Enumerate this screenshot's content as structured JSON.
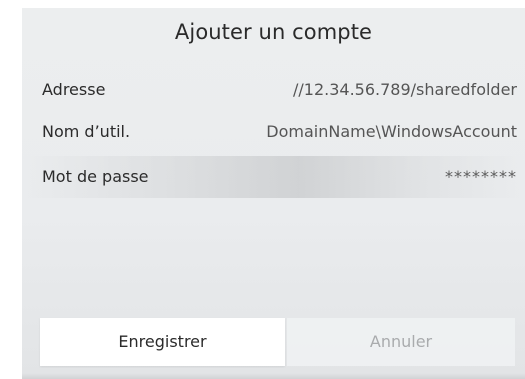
{
  "dialog": {
    "title": "Ajouter un compte",
    "fields": {
      "address": {
        "label": "Adresse",
        "value": "//12.34.56.789/sharedfolder"
      },
      "username": {
        "label": "Nom d’util.",
        "value": "DomainName\\WindowsAccount"
      },
      "password": {
        "label": "Mot de passe",
        "value": "********"
      }
    },
    "buttons": {
      "save_label": "Enregistrer",
      "cancel_label": "Annuler"
    }
  }
}
